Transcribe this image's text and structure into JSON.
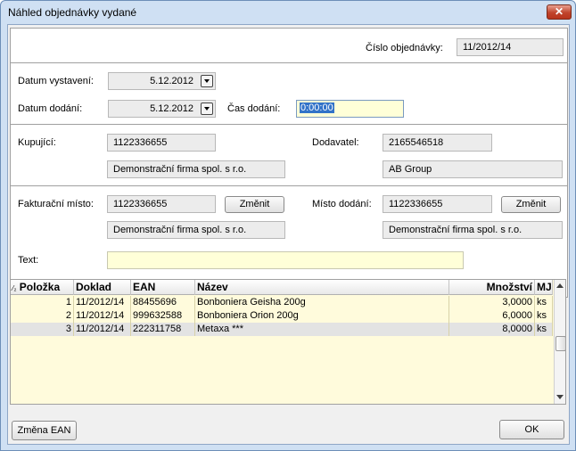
{
  "window": {
    "title": "Náhled objednávky vydané",
    "close_label": "✕"
  },
  "header": {
    "order_number_label": "Číslo objednávky:",
    "order_number_value": "11/2012/14"
  },
  "dates": {
    "issue_label": "Datum vystavení:",
    "issue_value": "5.12.2012",
    "delivery_label": "Datum dodání:",
    "delivery_value": "5.12.2012",
    "time_label": "Čas dodání:",
    "time_value": "0:00:00"
  },
  "parties": {
    "buyer_label": "Kupující:",
    "buyer_id": "1122336655",
    "buyer_name": "Demonstrační firma spol. s r.o.",
    "supplier_label": "Dodavatel:",
    "supplier_id": "2165546518",
    "supplier_name": "AB Group"
  },
  "places": {
    "billing_label": "Fakturační místo:",
    "billing_id": "1122336655",
    "billing_name": "Demonstrační firma spol. s r.o.",
    "billing_change": "Změnit",
    "delivery_label": "Místo dodání:",
    "delivery_id": "1122336655",
    "delivery_name": "Demonstrační firma spol. s r.o.",
    "delivery_change": "Změnit"
  },
  "text_field": {
    "label": "Text:",
    "value": ""
  },
  "grid": {
    "sort_indicator": "⁄₂",
    "columns": [
      "Položka",
      "Doklad",
      "EAN",
      "Název",
      "Množství",
      "MJ"
    ],
    "rows": [
      [
        "1",
        "11/2012/14",
        "88455696",
        "Bonboniera Geisha 200g",
        "3,0000",
        "ks"
      ],
      [
        "2",
        "11/2012/14",
        "999632588",
        "Bonboniera Orion 200g",
        "6,0000",
        "ks"
      ],
      [
        "3",
        "11/2012/14",
        "222311758",
        "Metaxa ***",
        "8,0000",
        "ks"
      ]
    ],
    "selected_row": 2
  },
  "footer": {
    "change_ean_label": "Změna EAN",
    "ok_label": "OK"
  },
  "colors": {
    "field_bg": "#ececec",
    "input_yellow": "#ffffd8",
    "grid_bg": "#fffbdc",
    "selection": "#3273c8"
  }
}
